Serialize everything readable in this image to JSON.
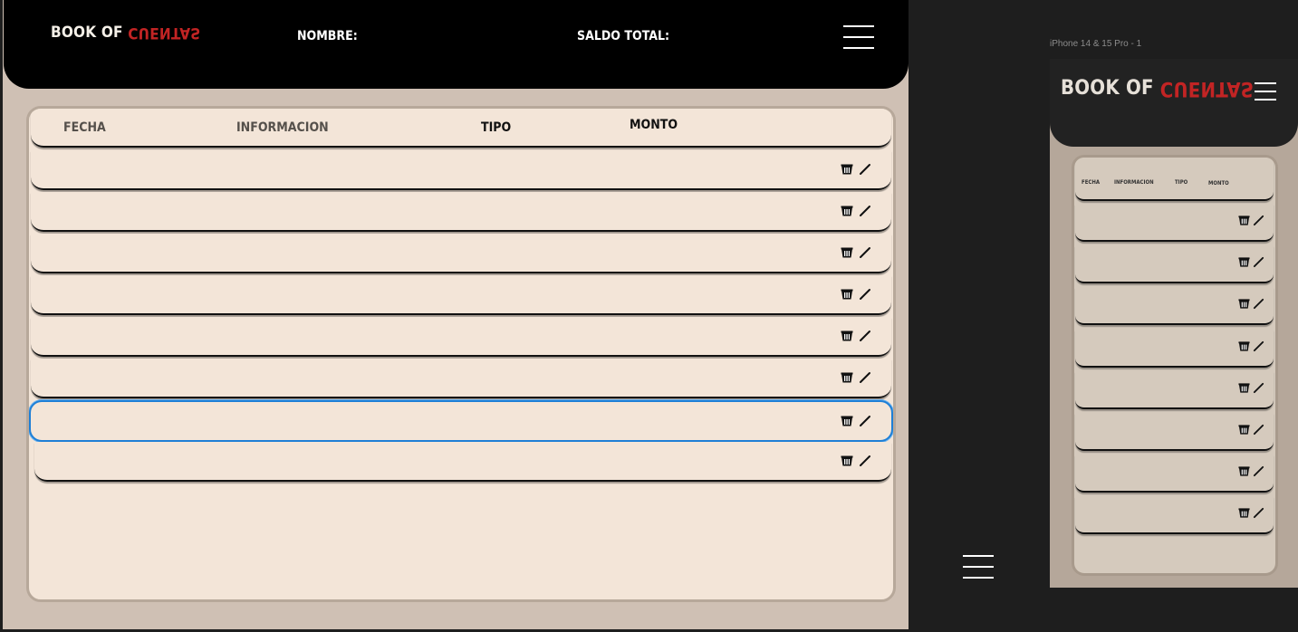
{
  "brand": {
    "word1": "BOOK OF",
    "word2": "CUENTAS"
  },
  "header": {
    "nombre_label": "NOMBRE:",
    "saldo_label": "SALDO TOTAL:"
  },
  "table": {
    "columns": [
      "FECHA",
      "INFORMACION",
      "TIPO",
      "MONTO"
    ],
    "row_count": 8,
    "selected_row_index": 6
  },
  "mobile": {
    "frame_label": "iPhone 14 & 15 Pro - 1",
    "columns": [
      "FECHA",
      "INFORMACION",
      "TIPO",
      "MONTO"
    ]
  },
  "icons": {
    "delete": "trash-icon",
    "edit": "pencil-icon",
    "menu": "hamburger-menu-icon"
  },
  "colors": {
    "header_bg": "#000000",
    "accent_red": "#c22424",
    "panel_bg": "#f3e5d8",
    "page_bg": "#cfc0b4",
    "selected_outline": "#1e7fd6"
  }
}
